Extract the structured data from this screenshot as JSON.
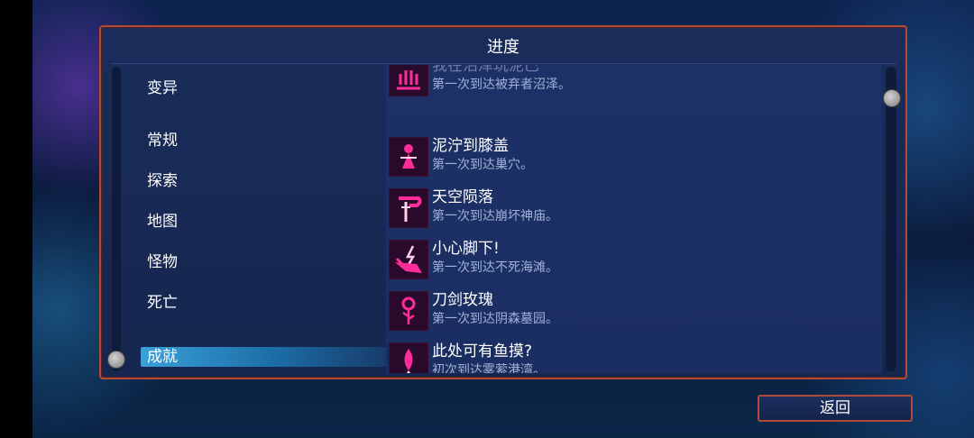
{
  "dialog": {
    "title": "进度"
  },
  "categories": [
    {
      "label": "变异",
      "selected": false
    },
    {
      "label": "常规",
      "selected": false
    },
    {
      "label": "探索",
      "selected": false
    },
    {
      "label": "地图",
      "selected": false
    },
    {
      "label": "怪物",
      "selected": false
    },
    {
      "label": "死亡",
      "selected": false
    },
    {
      "label": "成就",
      "selected": true
    }
  ],
  "achievements": [
    {
      "name": "我在沼泽玩泥巴",
      "desc": "第一次到达被弃者沼泽。",
      "icon": "swamp-icon",
      "partially_visible": true
    },
    {
      "name": "泥泞到膝盖",
      "desc": "第一次到达巢穴。",
      "icon": "girl-icon"
    },
    {
      "name": "天空陨落",
      "desc": "第一次到达崩坏神庙。",
      "icon": "sword-icon"
    },
    {
      "name": "小心脚下!",
      "desc": "第一次到达不死海滩。",
      "icon": "lightning-icon"
    },
    {
      "name": "刀剑玫瑰",
      "desc": "第一次到达阴森墓园。",
      "icon": "rose-icon"
    },
    {
      "name": "此处可有鱼摸?",
      "desc": "初次到达雾萦港湾。",
      "icon": "fish-icon"
    }
  ],
  "buttons": {
    "back_label": "返回"
  },
  "colors": {
    "accent_border": "#b04a3a",
    "selected_tab": "#3aa0d8",
    "icon_magenta": "#ff2d9a"
  }
}
